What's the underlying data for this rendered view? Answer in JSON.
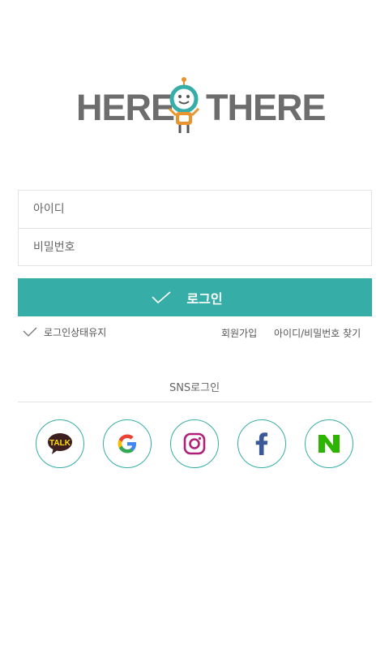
{
  "brand": {
    "left_word": "HERE",
    "right_word": "THERE"
  },
  "form": {
    "id_placeholder": "아이디",
    "password_placeholder": "비밀번호"
  },
  "login_button": {
    "label": "로그인"
  },
  "options": {
    "keep_login_label": "로그인상태유지",
    "signup_label": "회원가입",
    "find_label": "아이디/비밀번호 찾기"
  },
  "sns": {
    "title": "SNS로그인",
    "providers": [
      {
        "name": "kakao",
        "icon": "kakao-talk-icon",
        "icon_text": "TALK",
        "color": "#ffde00"
      },
      {
        "name": "google",
        "icon": "google-icon",
        "color": "#4285f4"
      },
      {
        "name": "instagram",
        "icon": "instagram-icon",
        "color": "#b02079"
      },
      {
        "name": "facebook",
        "icon": "facebook-icon",
        "color": "#3b5998"
      },
      {
        "name": "naver",
        "icon": "naver-icon",
        "color": "#2db400"
      }
    ]
  },
  "colors": {
    "accent": "#36ada6",
    "logo_gray": "#6d6d6d"
  }
}
